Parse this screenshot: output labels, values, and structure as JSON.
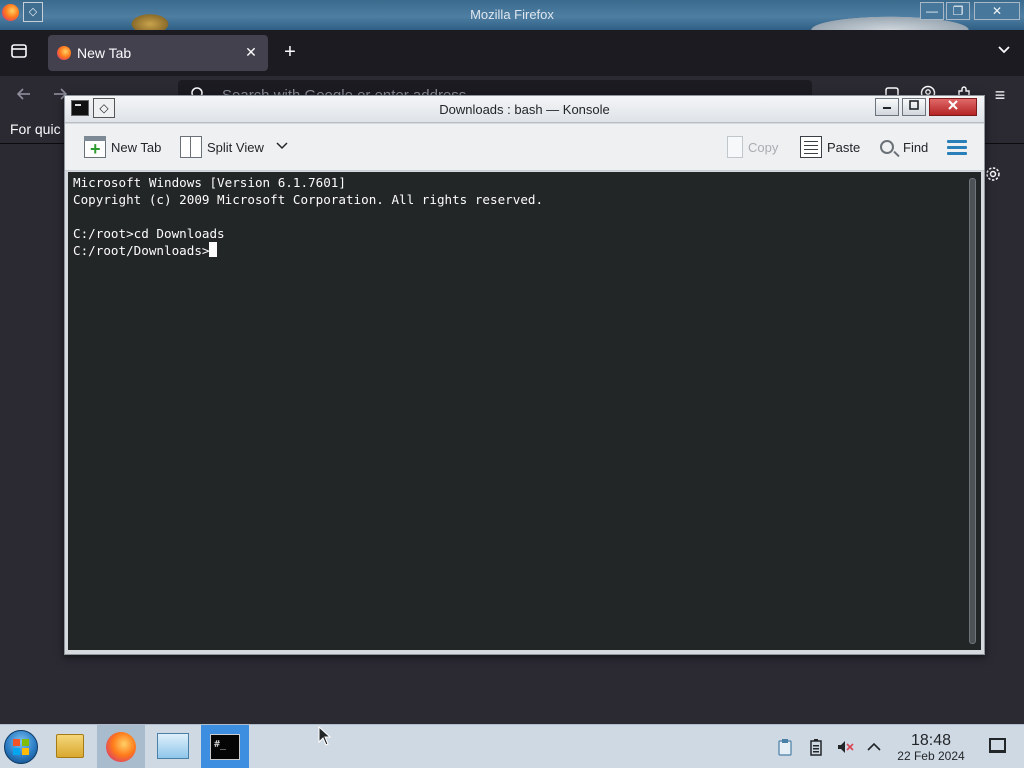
{
  "firefox": {
    "window_title": "Mozilla Firefox",
    "pin_glyph": "◇",
    "win_buttons": {
      "minimize": "—",
      "maximize": "❐",
      "close": "✕"
    },
    "tab": {
      "label": "New Tab",
      "close_glyph": "✕"
    },
    "new_tab_glyph": "+",
    "tab_list_glyph": "⌄",
    "urlbar": {
      "placeholder": "Search with Google or enter address"
    },
    "bookmarks_text": "For quic",
    "menu_glyph": "≡"
  },
  "konsole": {
    "window_title": "Downloads : bash — Konsole",
    "pin_glyph": "◇",
    "toolbar": {
      "new_tab": "New Tab",
      "split_view": "Split View",
      "copy": "Copy",
      "paste": "Paste",
      "find": "Find"
    },
    "terminal": {
      "lines": [
        "Microsoft Windows [Version 6.1.7601]",
        "Copyright (c) 2009 Microsoft Corporation. All rights reserved.",
        "",
        "C:/root>cd Downloads",
        "C:/root/Downloads>"
      ]
    }
  },
  "taskbar": {
    "items": [
      "start-menu",
      "file-manager",
      "firefox",
      "system-settings",
      "konsole"
    ],
    "clock": {
      "time": "18:48",
      "date": "22 Feb 2024"
    },
    "tray": [
      "clipboard-icon",
      "battery-icon",
      "volume-muted-icon",
      "tray-expand-icon"
    ]
  }
}
